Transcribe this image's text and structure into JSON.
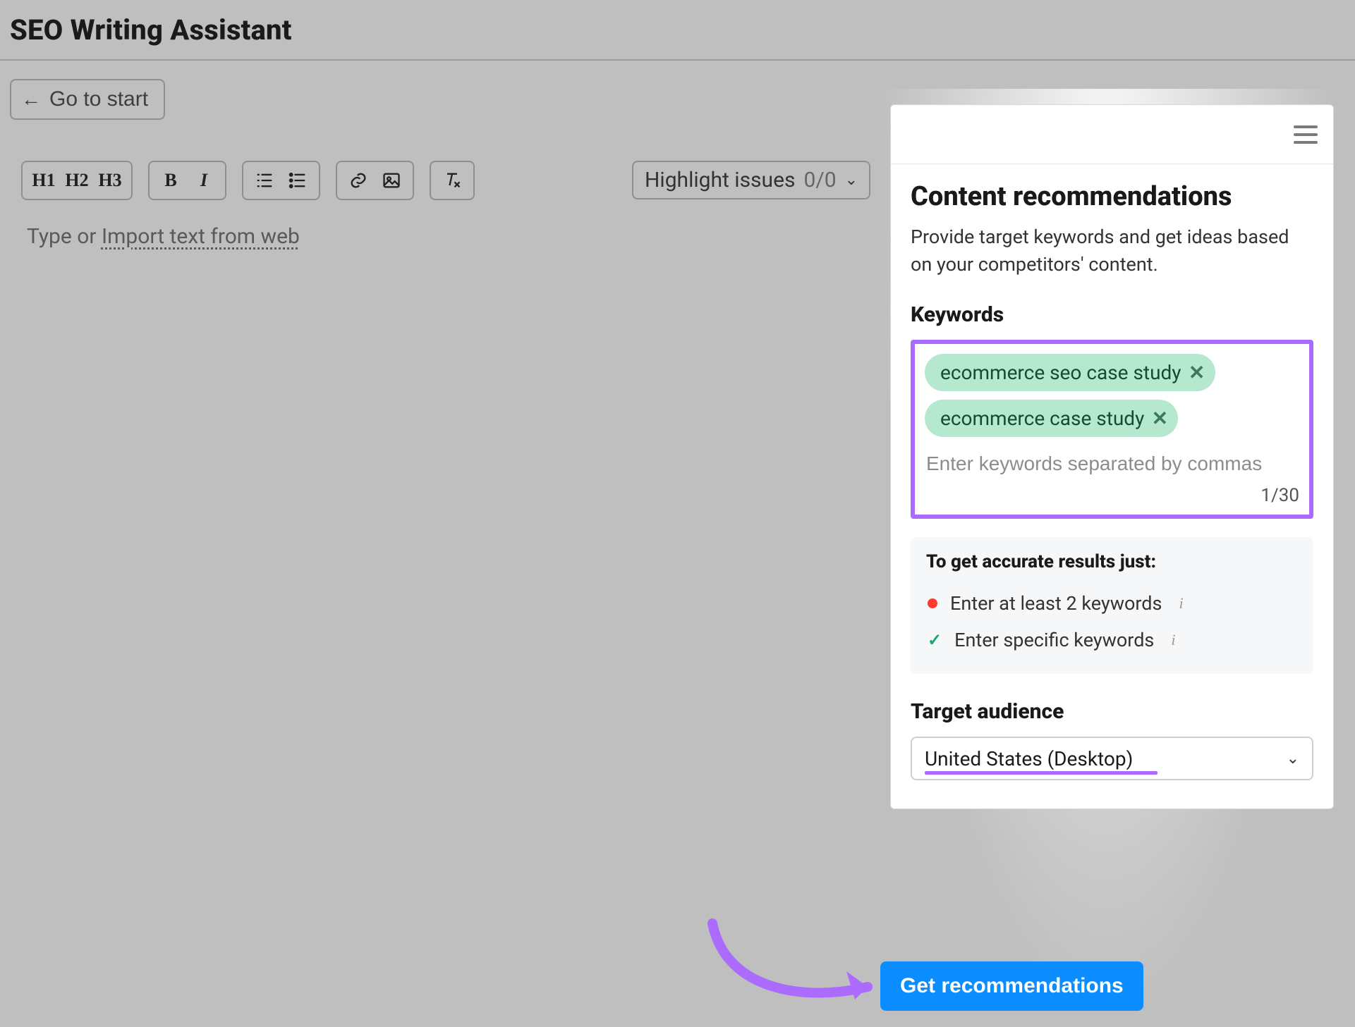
{
  "page_title": "SEO Writing Assistant",
  "go_to_start_label": "Go to start",
  "toolbar": {
    "h1": "H1",
    "h2": "H2",
    "h3": "H3",
    "bold": "B",
    "italic": "I",
    "highlight_label": "Highlight issues",
    "highlight_count": "0/0"
  },
  "editor": {
    "placeholder_prefix": "Type or ",
    "import_link": "Import text from web"
  },
  "panel": {
    "title": "Content recommendations",
    "description": "Provide target keywords and get ideas based on your competitors' content.",
    "keywords_label": "Keywords",
    "keyword_chips": [
      "ecommerce seo case study",
      "ecommerce case study"
    ],
    "keyword_placeholder": "Enter keywords separated by commas",
    "keyword_counter": "1/30",
    "accuracy": {
      "title": "To get accurate results just:",
      "item_red": "Enter at least 2 keywords",
      "item_green": "Enter specific keywords"
    },
    "target_audience_label": "Target audience",
    "target_audience_value": "United States (Desktop)",
    "get_button": "Get recommendations"
  }
}
